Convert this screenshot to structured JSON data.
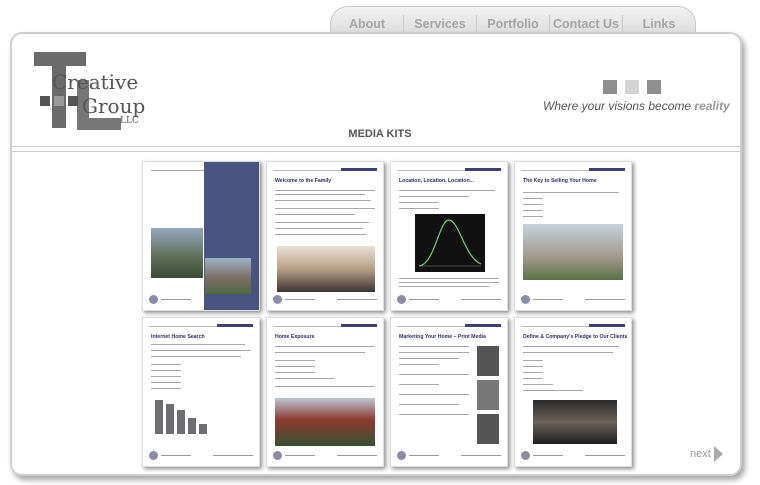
{
  "nav": {
    "items": [
      {
        "label": "About"
      },
      {
        "label": "Services"
      },
      {
        "label": "Portfolio"
      },
      {
        "label": "Contact Us"
      },
      {
        "label": "Links"
      }
    ]
  },
  "logo": {
    "line1": "Creative",
    "line2": "Group",
    "suffix": "LLC"
  },
  "tagline": {
    "text": "Where your visions become ",
    "accent": "reality"
  },
  "page": {
    "title": "MEDIA KITS"
  },
  "thumbnails": [
    {
      "title": ""
    },
    {
      "title": "Welcome to the Family"
    },
    {
      "title": "Location, Location, Location..."
    },
    {
      "title": "The Key to Selling Your Home"
    },
    {
      "title": "Internet Home Search"
    },
    {
      "title": "Home Exposure"
    },
    {
      "title": "Marketing Your Home – Print Media"
    },
    {
      "title": "Define & Company's Pledge to Our Clients"
    }
  ],
  "pager": {
    "next_label": "next"
  },
  "colors": {
    "accent_navy": "#3d3f7a",
    "nav_text": "#a4a4a4",
    "logo_gray": "#555555"
  }
}
